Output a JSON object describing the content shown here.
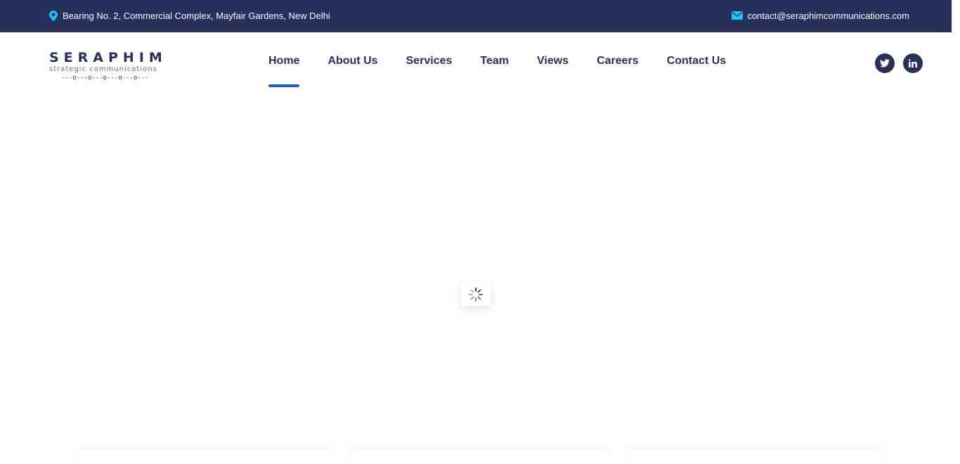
{
  "topbar": {
    "address": "Bearing No. 2, Commercial Complex, Mayfair Gardens, New Delhi",
    "address_icon": "map-marker-icon",
    "email": "contact@seraphimcommunications.com",
    "email_icon": "envelope-icon"
  },
  "logo": {
    "wordmark": "SERAPHIM",
    "tagline": "strategic communications",
    "chain": "---o---o---o---o---o---"
  },
  "nav": {
    "items": [
      {
        "label": "Home",
        "active": true
      },
      {
        "label": "About Us"
      },
      {
        "label": "Services"
      },
      {
        "label": "Team"
      },
      {
        "label": "Views"
      },
      {
        "label": "Careers"
      },
      {
        "label": "Contact Us"
      }
    ]
  },
  "social": {
    "twitter_icon": "twitter-icon",
    "linkedin_icon": "linkedin-icon"
  },
  "colors": {
    "topbar_bg": "#27305a",
    "accent": "#1c5ac7",
    "icon_cyan": "#1ec3f0"
  }
}
